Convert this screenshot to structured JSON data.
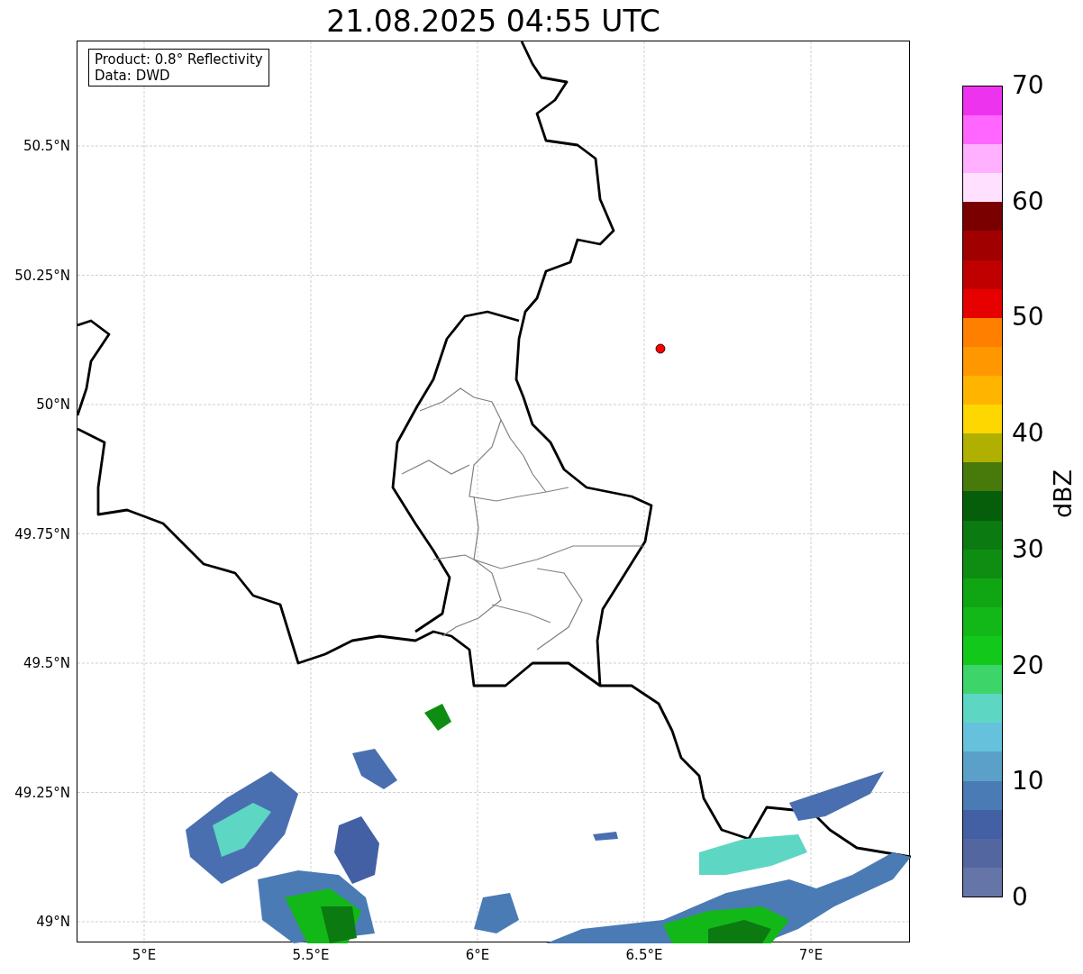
{
  "title": "21.08.2025 04:55 UTC",
  "info_box": {
    "lines": [
      "Product: 0.8° Reflectivity",
      "Data: DWD"
    ]
  },
  "map": {
    "x_ticks": [
      "5°E",
      "5.5°E",
      "6°E",
      "6.5°E",
      "7°E"
    ],
    "y_ticks": [
      "50.5°N",
      "50.25°N",
      "50°N",
      "49.75°N",
      "49.5°N",
      "49.25°N",
      "49°N"
    ],
    "marker": {
      "color": "#ff0000"
    }
  },
  "colorbar": {
    "label": "dBZ",
    "ticks": [
      "70",
      "60",
      "50",
      "40",
      "30",
      "20",
      "10",
      "0"
    ],
    "bands": [
      {
        "color": "#6675a8"
      },
      {
        "color": "#5466a0"
      },
      {
        "color": "#4360a4"
      },
      {
        "color": "#4a7bb4"
      },
      {
        "color": "#5aa0c8"
      },
      {
        "color": "#66c2dc"
      },
      {
        "color": "#5ed6c4"
      },
      {
        "color": "#3dd46a"
      },
      {
        "color": "#12c81a"
      },
      {
        "color": "#12b818"
      },
      {
        "color": "#10a512"
      },
      {
        "color": "#0e8d12"
      },
      {
        "color": "#0b7a10"
      },
      {
        "color": "#075e0a"
      },
      {
        "color": "#477a0a"
      },
      {
        "color": "#b0b000"
      },
      {
        "color": "#ffd700"
      },
      {
        "color": "#ffb400"
      },
      {
        "color": "#ff9800"
      },
      {
        "color": "#ff7f00"
      },
      {
        "color": "#e60000"
      },
      {
        "color": "#c00000"
      },
      {
        "color": "#a00000"
      },
      {
        "color": "#7a0000"
      },
      {
        "color": "#ffe0ff"
      },
      {
        "color": "#ffb0ff"
      },
      {
        "color": "#ff66ff"
      },
      {
        "color": "#ee33ee"
      }
    ]
  }
}
